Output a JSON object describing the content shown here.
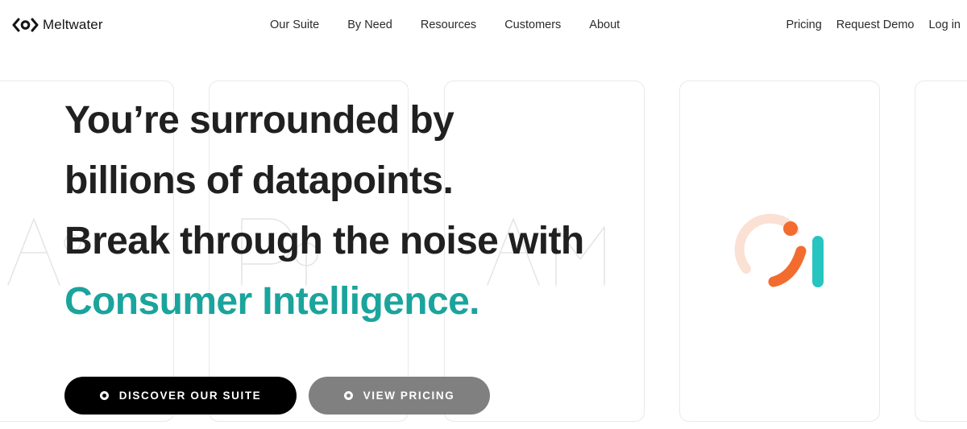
{
  "header": {
    "logo_text": "Meltwater",
    "logo_icon": "meltwater-logo-icon",
    "nav": [
      {
        "label": "Our Suite"
      },
      {
        "label": "By Need"
      },
      {
        "label": "Resources"
      },
      {
        "label": "Customers"
      },
      {
        "label": "About"
      }
    ],
    "right_nav": {
      "pricing": "Pricing",
      "request_demo": "Request Demo",
      "login": "Log in"
    }
  },
  "hero": {
    "lines": [
      "You’re surrounded by",
      "billions of datapoints.",
      "Break through the noise with"
    ],
    "accent_line": "Consumer Intelligence.",
    "accent_color": "#1aa49c"
  },
  "buttons": {
    "primary": {
      "label": "DISCOVER OUR SUITE",
      "icon": "circle-icon",
      "color": "#000000"
    },
    "secondary": {
      "label": "VIEW PRICING",
      "icon": "circle-icon",
      "color": "#808080"
    }
  },
  "graphic": {
    "icon": "brand-ring-graphic",
    "colors": {
      "ring": "#fbe0d4",
      "orange": "#f36c2f",
      "teal": "#27c5bf"
    }
  }
}
